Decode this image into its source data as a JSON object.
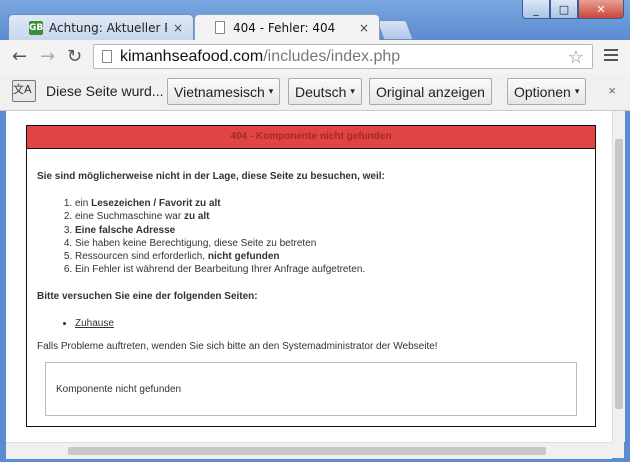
{
  "tabs": [
    {
      "label": "Achtung: Aktueller Phishing",
      "favicon": "GB"
    },
    {
      "label": "404 - Fehler: 404"
    }
  ],
  "window_controls": {
    "minimize": "_",
    "maximize": "□",
    "close": "✕"
  },
  "tab_close": "×",
  "address": {
    "domain": "kimanhseafood.com",
    "path": "/includes/index.php"
  },
  "nav": {
    "back": "←",
    "forward": "→",
    "reload": "↻",
    "star": "☆"
  },
  "translate_bar": {
    "icon_text": "文A",
    "message": "Diese Seite wurd...",
    "from_lang": "Vietnamesisch",
    "to_lang": "Deutsch",
    "show_original": "Original anzeigen",
    "options": "Optionen",
    "close": "×",
    "caret": "▾"
  },
  "error": {
    "header": "404 - Komponente nicht gefunden",
    "intro": "Sie sind möglicherweise nicht in der Lage, diese Seite zu besuchen, weil:",
    "reasons": [
      {
        "pre": "ein ",
        "bold": "Lesezeichen / Favorit zu alt",
        "post": ""
      },
      {
        "pre": "eine Suchmaschine war ",
        "bold": "zu alt",
        "post": ""
      },
      {
        "pre": "",
        "bold": "Eine falsche Adresse",
        "post": ""
      },
      {
        "pre": "Sie haben keine Berechtigung, diese Seite zu betreten",
        "bold": "",
        "post": ""
      },
      {
        "pre": "Ressourcen sind erforderlich, ",
        "bold": "nicht gefunden",
        "post": ""
      },
      {
        "pre": "Ein Fehler ist während der Bearbeitung Ihrer Anfrage aufgetreten.",
        "bold": "",
        "post": ""
      }
    ],
    "please": "Bitte versuchen Sie eine der folgenden Seiten:",
    "links": [
      "Zuhause"
    ],
    "contact": "Falls Probleme auftreten, wenden Sie sich bitte an den Systemadministrator der Webseite!",
    "message": "Komponente nicht gefunden"
  }
}
